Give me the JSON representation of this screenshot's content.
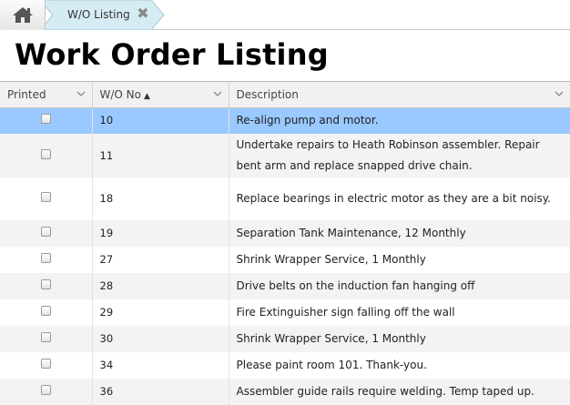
{
  "breadcrumb": {
    "home_icon": "home-icon",
    "tab_label": "W/O Listing",
    "close_icon": "close-icon",
    "close_glyph": "✖"
  },
  "page": {
    "title": "Work Order Listing"
  },
  "grid": {
    "columns": [
      {
        "label": "Printed",
        "sorted": ""
      },
      {
        "label": "W/O No",
        "sorted": "▲"
      },
      {
        "label": "Description",
        "sorted": ""
      }
    ],
    "rows": [
      {
        "printed": false,
        "wo_no": "10",
        "description": "Re-align pump and motor."
      },
      {
        "printed": false,
        "wo_no": "11",
        "description": "Undertake repairs to Heath Robinson assembler. Repair bent arm and replace snapped drive chain."
      },
      {
        "printed": false,
        "wo_no": "18",
        "description": "Replace bearings in electric motor as they are a bit noisy."
      },
      {
        "printed": false,
        "wo_no": "19",
        "description": "Separation Tank Maintenance, 12 Monthly"
      },
      {
        "printed": false,
        "wo_no": "27",
        "description": "Shrink Wrapper Service, 1 Monthly"
      },
      {
        "printed": false,
        "wo_no": "28",
        "description": "Drive belts on the induction fan hanging off"
      },
      {
        "printed": false,
        "wo_no": "29",
        "description": "Fire Extinguisher sign falling off the wall"
      },
      {
        "printed": false,
        "wo_no": "30",
        "description": "Shrink Wrapper Service, 1 Monthly"
      },
      {
        "printed": false,
        "wo_no": "34",
        "description": "Please paint room 101. Thank-you."
      },
      {
        "printed": false,
        "wo_no": "36",
        "description": "Assembler guide rails require welding. Temp taped up."
      }
    ],
    "selected_row": 0
  },
  "colors": {
    "selected_row": "#99c9ff",
    "alt_row": "#f3f3f3",
    "tab_active": "#d9edf5"
  }
}
